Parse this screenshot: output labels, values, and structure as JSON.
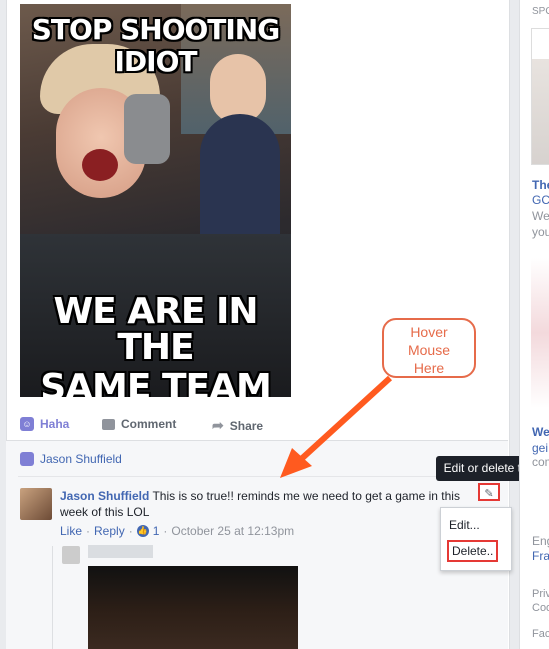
{
  "meme": {
    "caption_top": [
      "STOP SHOOTING",
      "IDIOT"
    ],
    "caption_bottom": [
      "WE ARE IN THE",
      "SAME TEAM"
    ]
  },
  "actions": {
    "haha": "Haha",
    "comment": "Comment",
    "share": "Share"
  },
  "reactor": {
    "name": "Jason Shuffield"
  },
  "comment": {
    "author": "Jason Shuffield",
    "text": "This is so true!! reminds me we need to get a game in this week of this LOL",
    "like": "Like",
    "reply": "Reply",
    "like_count": "1",
    "timestamp": "October 25 at 12:13pm"
  },
  "tooltip": "Edit or delete this",
  "menu": {
    "edit": "Edit...",
    "delete": "Delete.."
  },
  "callout": [
    "Hover",
    "Mouse",
    "Here"
  ],
  "right": {
    "sponsored": "SPO",
    "ad_title_1": "The",
    "ad_line_1": "GC",
    "ad_line_2": "We",
    "ad_line_3": "you",
    "ad_title_2": "We",
    "ad_line_4": "gei",
    "ad_line_5": "com",
    "lang1": "Eng",
    "lang2": "Fra",
    "footer1": "Priv",
    "footer2": "Coo",
    "footer3": "Fac"
  },
  "colors": {
    "accent": "#4267b2",
    "haha": "#7f7fd5",
    "highlight": "#e53935",
    "callout": "#e66b4a"
  }
}
